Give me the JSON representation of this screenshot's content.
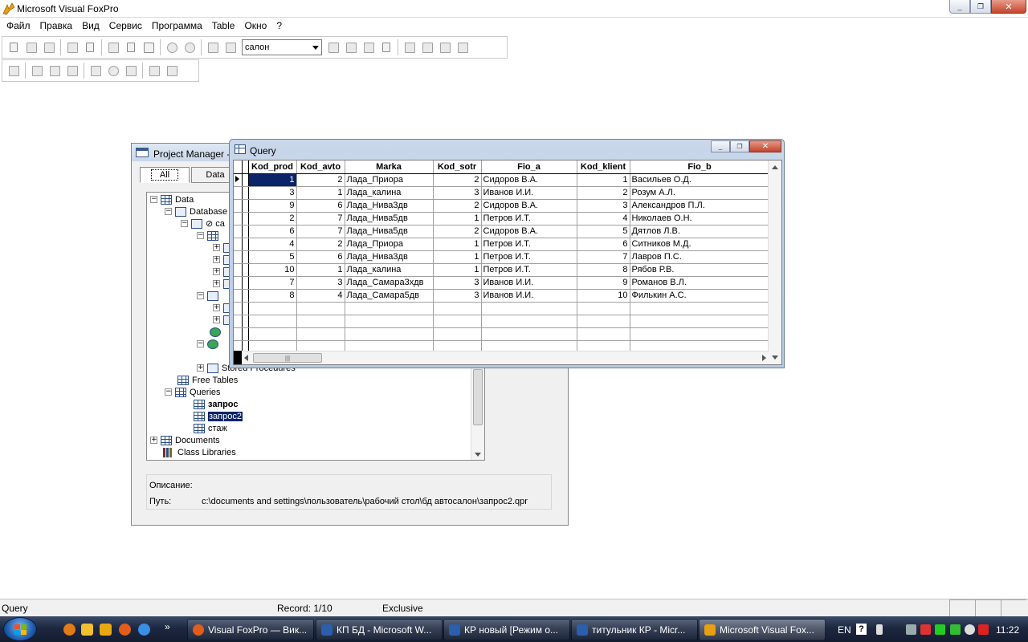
{
  "app": {
    "title": "Microsoft Visual FoxPro"
  },
  "window_controls": {
    "minimize": "_",
    "restore": "❐",
    "close": "✕"
  },
  "menu": [
    "Файл",
    "Правка",
    "Вид",
    "Сервис",
    "Программа",
    "Table",
    "Окно",
    "?"
  ],
  "toolbar": {
    "database_combo": "салон"
  },
  "project_manager": {
    "title": "Project Manager -",
    "tabs": {
      "all": "All",
      "data": "Data"
    },
    "tree": {
      "data": "Data",
      "databases": "Database",
      "db_item": "⊘ ca",
      "free_tables": "Free Tables",
      "queries": "Queries",
      "query1": "запрос",
      "query2": "запрос2",
      "query3": "стаж",
      "stored_procedures": "Stored Procedures",
      "documents": "Documents",
      "class_libraries": "Class Libraries"
    },
    "description_label": "Описание:",
    "path_label": "Путь:",
    "path_value": "c:\\documents and settings\\пользователь\\рабочий стол\\бд автосалон\\запрос2.qpr"
  },
  "query_window": {
    "title": "Query",
    "columns": [
      "Kod_prod",
      "Kod_avto",
      "Marka",
      "Kod_sotr",
      "Fio_a",
      "Kod_klient",
      "Fio_b"
    ],
    "rows": [
      [
        "1",
        "2",
        "Лада_Приора",
        "2",
        "Сидоров В.А.",
        "1",
        "Васильев О.Д."
      ],
      [
        "3",
        "1",
        "Лада_калина",
        "3",
        "Иванов И.И.",
        "2",
        "Розум А.Л."
      ],
      [
        "9",
        "6",
        "Лада_Нива3дв",
        "2",
        "Сидоров В.А.",
        "3",
        "Александров П.Л."
      ],
      [
        "2",
        "7",
        "Лада_Нива5дв",
        "1",
        "Петров И.Т.",
        "4",
        "Николаев О.Н."
      ],
      [
        "6",
        "7",
        "Лада_Нива5дв",
        "2",
        "Сидоров В.А.",
        "5",
        "Дятлов Л.В."
      ],
      [
        "4",
        "2",
        "Лада_Приора",
        "1",
        "Петров И.Т.",
        "6",
        "Ситников М.Д."
      ],
      [
        "5",
        "6",
        "Лада_Нива3дв",
        "1",
        "Петров И.Т.",
        "7",
        "Лавров П.С."
      ],
      [
        "10",
        "1",
        "Лада_калина",
        "1",
        "Петров И.Т.",
        "8",
        "Рябов Р.В."
      ],
      [
        "7",
        "3",
        "Лада_Самара3хдв",
        "3",
        "Иванов И.И.",
        "9",
        "Романов В.Л."
      ],
      [
        "8",
        "4",
        "Лада_Самара5дв",
        "3",
        "Иванов И.И.",
        "10",
        "Филькин А.С."
      ]
    ],
    "scroll_grip": "|||"
  },
  "status": {
    "left": "Query",
    "record": "Record: 1/10",
    "mode": "Exclusive"
  },
  "taskbar": {
    "tasks": [
      "Visual FoxPro — Вик...",
      "КП БД - Microsoft W...",
      "КР новый [Режим о...",
      "титульник КР - Micr...",
      "Microsoft Visual Fox..."
    ],
    "lang": "EN",
    "help": "?",
    "clock": "11:22",
    "more": "»"
  },
  "colors": {
    "selection": "#0a246a",
    "taskbar": "#1d2840"
  }
}
